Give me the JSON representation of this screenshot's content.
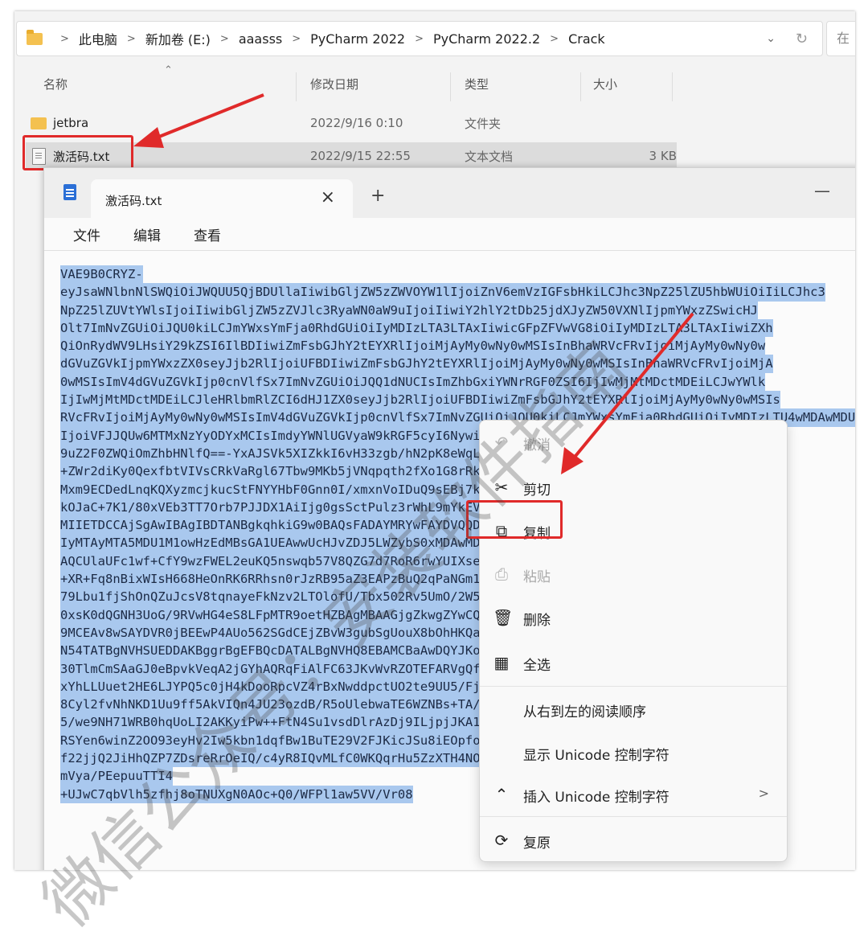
{
  "explorer": {
    "breadcrumb": [
      "此电脑",
      "新加卷 (E:)",
      "aaasss",
      "PyCharm 2022",
      "PyCharm 2022.2",
      "Crack"
    ],
    "search_placeholder": "在",
    "columns": {
      "name": "名称",
      "date": "修改日期",
      "type": "类型",
      "size": "大小"
    },
    "files": [
      {
        "name": "jetbra",
        "date": "2022/9/16 0:10",
        "type": "文件夹",
        "size": "",
        "icon": "folder-icon"
      },
      {
        "name": "激活码.txt",
        "date": "2022/9/15 22:55",
        "type": "文本文档",
        "size": "3 KB",
        "icon": "text-file-icon"
      }
    ]
  },
  "notepad": {
    "tab_title": "激活码.txt",
    "menu": [
      "文件",
      "编辑",
      "查看"
    ],
    "lines": [
      "VAE9B0CRYZ-",
      "eyJsaWNlbnNlSWQiOiJWQUU5QjBDUllaIiwibGljZW5zZWVOYW1lIjoiZnV6emVzIGFsbHkiLCJhc3NpZ25lZU5hbWUiOiIiLCJhc3",
      "NpZ25lZUVtYWlsIjoiIiwibGljZW5zZVJlc3RyaWN0aW9uIjoiIiwiY2hlY2tDb25jdXJyZW50VXNlIjpmYWxzZSwicHJ",
      "Olt7ImNvZGUiOiJQU0kiLCJmYWxsYmFja0RhdGUiOiIyMDIzLTA3LTAxIiwicGFpZFVwVG8iOiIyMDIzLTA3LTAxIiwiZXh",
      "QiOnRydWV9LHsiY29kZSI6IlBDIiwiZmFsbGJhY2tEYXRlIjoiMjAyMy0wNy0wMSIsInBhaWRVcFRvIjoiMjAyMy0wNy0w",
      "dGVuZGVkIjpmYWxzZX0seyJjb2RlIjoiUFBDIiwiZmFsbGJhY2tEYXRlIjoiMjAyMy0wNy0wMSIsInBhaWRVcFRvIjoiMjA",
      "0wMSIsImV4dGVuZGVkIjp0cnVlfSx7ImNvZGUiOiJQQ1dNUCIsImZhbGxiYWNrRGF0ZSI6IjIwMjMtMDctMDEiLCJwYWlk",
      "IjIwMjMtMDctMDEiLCJleHRlbmRlZCI6dHJ1ZX0seyJjb2RlIjoiUFBDIiwiZmFsbGJhY2tEYXRlIjoiMjAyMy0wNy0wMSIs",
      "RVcFRvIjoiMjAyMy0wNy0wMSIsImV4dGVuZGVkIjp0cnVlfSx7ImNvZGUiOiJQU0kiLCJmYWxsYmFja0RhdGUiOiIyMDIzLTU4wMDAwMDU",
      "IjoiVFJJQUw6MTMxNzYyODYxMCIsImdyYWNlUGVyaW9kRGF5cyI6NywiYXV0b1Byb2xvbmdhdGVkIjpmYWxzZSwiaXNBdXR",
      "9uZ2F0ZWQiOmZhbHNlfQ==-YxAJSVk5XIZkkI6vH33zgb/hN2pK8eWqL0tVb7sFg9cM4xUdO1rIwPjHyQbCmm0qRYLBYBE",
      "+ZWr2diKy0QexfbtVIVsCRkVaRgl67Tbw9MKb5jVNqpqth2fXo1G8rRkLmTYs4DcA0wBnJgeUyZPkV3hZQvMb2TrJ5hz05",
      "Mxm9ECDedLnqKQXyzmcjkucStFNYYHbF0Gnn0I/xmxnVoIDuQ9sEBj7kR1pWn6aL3tZfHcGyOe2MwXrTqCI1dYPYF1V",
      "kOJaC+7K1/80xVEb3TT7Orb7PJJDX1AiIjg0gsSctPulz3rWhL9mYkEVbC5qTfRjAoU8Zp2NsGxKdItQ4e",
      "MIIETDCCAjSgAwIBAgIBDTANBgkqhkiG9w0BAQsFADAYMRYwFAYDVQQDDA1KZXRQcm9maWxlIENBMB4XDTIwMTAxOTA5M",
      "IyMTAyMTA5MDU1M1owHzEdMBsGA1UEAwwUcHJvZDJ5LWZybS0xMDAwMDAwMDAwMIIBIjANBgkqhkiG9w0BAQUAA4IBDwA",
      "AQCUlaUFc1wf+CfY9wzFWEL2euKQ5nswqb57V8QZG7d7RoR6rwYUIXseTOAFq210oMEe++LCjzKDuqwDfsyhgDNTgZBPA",
      "+XR+Fq8nBixWIsH668HeOnRK6RRhsn0rJzRB95aZ3EAPzBuQ2qPaNGm17pAX0Rd6MPRgjp75IWwI9eA6aMEdPQEVN7uyO",
      "79Lbu1fjShOnQZuJcsV8tqnayeFkNzv2LTOlofU/Tbx502Rv5UmO/2W5Fx8nc6ZHD7ghX9FiTnLyxI9P3pNMk0s2z8/COMrx",
      "0xsK0dQGNH3UoG/9RVwHG4eS8LFpMTR9oetHZBAgMBAAGjgZkwgZYwCQYDVR0TBAIwADAdBgNVHQ4EFgQUJNoRIpb1hUH",
      "9MCEAv8wSAYDVR0jBEEwP4AUo562SGdCEjZBvW3gubSgUouX8bOhHKQaMBgxFjAUBgNVBAMMDUpldFByb2ZpbGUgQ0GCC",
      "N54TATBgNVHSUEDDAKBggrBgEFBQcDATALBgNVHQ8EBAMCBaAwDQYJKoZIhvcNAQELBQADggIBAI6tHEGoxQct9dQUFK8",
      "30TlmCmSAaGJ0eBpvkVeqA2jGYhAQRqFiAlFC63JKvWvRZOTEFARVgQfAmlTmpCpZPFIlLhmZ8aB1kLwWuFcEZ8TK3s",
      "xYhLLUuet2HE6LJYPQ5c0jH4kDooRpcVZ4rBxNwddpctUO2te9UU5/FjhioZQsPvd92qOTsV+8Cyl2fv",
      "8Cyl2fvNhNKD1Uu9ff5AkVIQn4JU23ozdB/R5oUlebwaTE6WZNBs+TA/qPj+5/we9NH71WRB0hqUoLI2AKK",
      "5/we9NH71WRB0hqUoLI2AKKyiPw++FtN4Su1vsdDlrAzDj9ILjpjJKA1ImuVcG329/WTYIKysZ1CWK3zATg9BeCUPAV1p",
      "RSYen6winZ2OO93eyHv2Iw5kbn1dqfBw1BuTE29V2FJKicJSu8iEOpfoafwJISXmz1wnnWL3V/0NxTulfWsXugOoLfv0Z",
      "f22jjQ2JiHhQZP7ZDsreRrOeIQ/c4yR8IQvMLfC0WKQqrHu5ZzXTH4NO3CwGWSlTY74kE91zXB5mwWAx1jig+UXYc2w4R",
      "mVya/PEepuuTTI4",
      "+UJwC7qbVlh5zfhj8oTNUXgN0AOc+Q0/WFPl1aw5VV/Vr08"
    ]
  },
  "context_menu": {
    "items": [
      {
        "label": "撤消",
        "icon": "undo-icon",
        "enabled": false
      },
      {
        "label": "剪切",
        "icon": "scissors-icon",
        "enabled": true
      },
      {
        "label": "复制",
        "icon": "copy-icon",
        "enabled": true
      },
      {
        "label": "粘贴",
        "icon": "paste-icon",
        "enabled": false
      },
      {
        "label": "删除",
        "icon": "trash-icon",
        "enabled": true
      },
      {
        "label": "全选",
        "icon": "select-all-icon",
        "enabled": true
      },
      {
        "label": "从右到左的阅读顺序",
        "icon": "",
        "enabled": true
      },
      {
        "label": "显示 Unicode 控制字符",
        "icon": "",
        "enabled": true
      },
      {
        "label": "插入 Unicode 控制字符",
        "icon": "caret-icon",
        "enabled": true
      },
      {
        "label": "复原",
        "icon": "redo-icon",
        "enabled": true
      }
    ]
  },
  "watermark": {
    "text": "微信公众号：安装软件指南"
  },
  "colors": {
    "highlight": "#e02a2a",
    "selection": "#a9c8ee",
    "folder": "#f4c150"
  }
}
